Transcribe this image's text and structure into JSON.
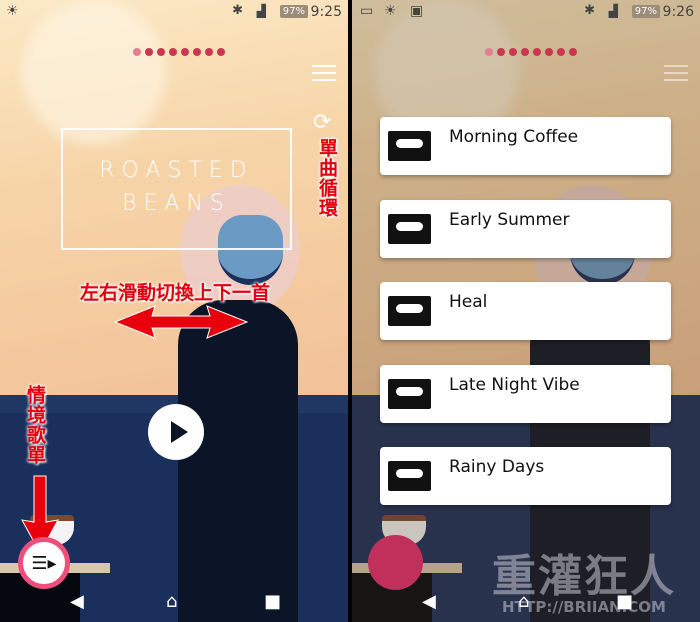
{
  "left": {
    "status": {
      "time": "9:25",
      "battery": "97%"
    },
    "album_title_line1": "ROASTED",
    "album_title_line2": "BEANS",
    "page_dots": 8,
    "annotations": {
      "repeat": "單曲循環",
      "swipe": "左右滑動切換上下一首",
      "playlist": "情境歌單"
    },
    "fab_icon": "playlist-play-icon"
  },
  "right": {
    "status": {
      "time": "9:26",
      "battery": "97%"
    },
    "playlists": [
      {
        "name": "Morning Coffee"
      },
      {
        "name": "Early Summer"
      },
      {
        "name": "Heal"
      },
      {
        "name": "Late Night Vibe"
      },
      {
        "name": "Rainy Days"
      }
    ],
    "watermark": "重灌狂人 HTTP://BRIIAN.COM"
  },
  "colors": {
    "accent": "#c9384f",
    "fab_ring": "#ee4f7a",
    "wall": "#1b2f5c",
    "annotation": "#e0000f"
  }
}
